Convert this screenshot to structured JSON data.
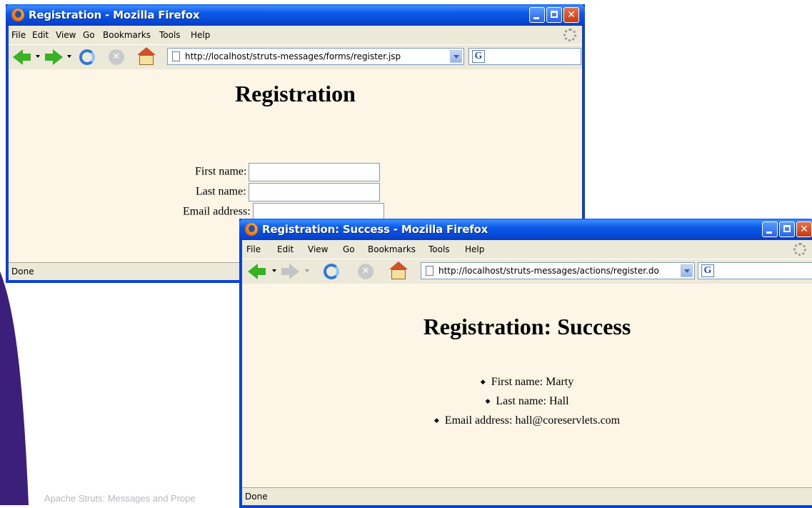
{
  "footer": "Apache Struts: Messages and Prope",
  "windows": [
    {
      "title": "Registration - Mozilla Firefox",
      "menu": [
        "File",
        "Edit",
        "View",
        "Go",
        "Bookmarks",
        "Tools",
        "Help"
      ],
      "url": "http://localhost/struts-messages/forms/register.jsp",
      "forward_enabled": true,
      "heading": "Registration",
      "form": {
        "first_name_label": "First name:",
        "last_name_label": "Last name:",
        "email_label": "Email address:",
        "first_name_value": "",
        "last_name_value": "",
        "email_value": ""
      },
      "status": "Done"
    },
    {
      "title": "Registration: Success - Mozilla Firefox",
      "menu": [
        "File",
        "Edit",
        "View",
        "Go",
        "Bookmarks",
        "Tools",
        "Help"
      ],
      "url": "http://localhost/struts-messages/actions/register.do",
      "forward_enabled": false,
      "heading": "Registration: Success",
      "results": [
        "First name: Marty",
        "Last name: Hall",
        "Email address: hall@coreservlets.com"
      ],
      "status": "Done"
    }
  ],
  "colors": {
    "titlebar": "#0a5cf0",
    "page_background": "#fdf5e6",
    "chrome": "#ece9d8",
    "accent_left": "#3b1f7a"
  }
}
